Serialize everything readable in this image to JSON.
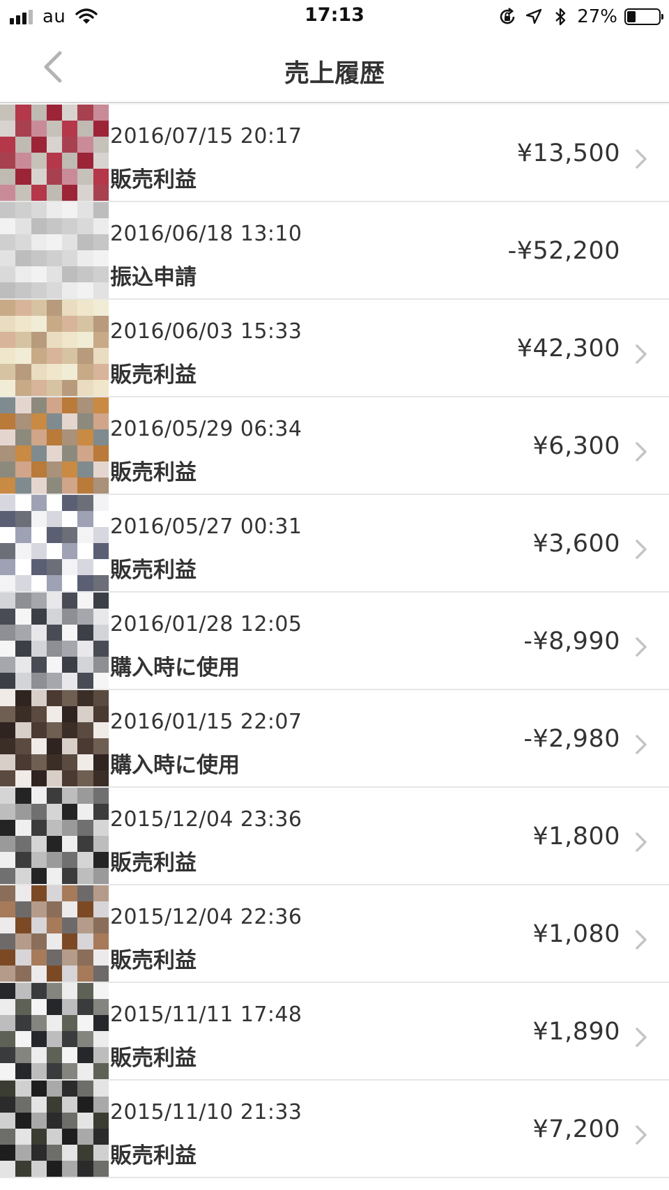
{
  "status_bar": {
    "carrier": "au",
    "time": "17:13",
    "battery_percent": "27%",
    "battery_level": 0.27,
    "signal_bars_active": 3,
    "signal_bars_total": 4,
    "icons": [
      "rotation-lock-icon",
      "location-icon",
      "bluetooth-icon"
    ]
  },
  "nav": {
    "title": "売上履歴",
    "back_icon": "chevron-left-icon"
  },
  "colors": {
    "chevron": "#c4c4c4",
    "back_arrow": "#b3b3b3",
    "separator": "#e6e6e6",
    "text": "#333333"
  },
  "transactions": [
    {
      "date": "2016/07/15 20:17",
      "type": "販売利益",
      "amount": "¥13,500",
      "has_chevron": true,
      "palette": [
        "#c6c1b9",
        "#a8414f",
        "#9c2437",
        "#b4374a",
        "#c98b98",
        "#d8d3cf",
        "#bfbab2"
      ]
    },
    {
      "date": "2016/06/18 13:10",
      "type": "振込申請",
      "amount": "-¥52,200",
      "has_chevron": false,
      "palette": [
        "#d9d9d9",
        "#c6c6c6",
        "#e2e2e2",
        "#ececec",
        "#cfcfcf",
        "#bdbdbd",
        "#f2f2f2"
      ]
    },
    {
      "date": "2016/06/03 15:33",
      "type": "販売利益",
      "amount": "¥42,300",
      "has_chevron": true,
      "palette": [
        "#e9dcc0",
        "#d6c3a2",
        "#c8aa86",
        "#efe6cb",
        "#b79b7c",
        "#d7b49a",
        "#f1ecd6"
      ]
    },
    {
      "date": "2016/05/29 06:34",
      "type": "販売利益",
      "amount": "¥6,300",
      "has_chevron": true,
      "palette": [
        "#c98a43",
        "#b97a3a",
        "#8c8a7d",
        "#7f8b8e",
        "#a9917a",
        "#d0a58a",
        "#e4d6cf"
      ]
    },
    {
      "date": "2016/05/27 00:31",
      "type": "販売利益",
      "amount": "¥3,600",
      "has_chevron": true,
      "palette": [
        "#ffffff",
        "#f3f3f5",
        "#5b5f74",
        "#9ea2b4",
        "#d7d8df",
        "#6c6e78",
        "#ffffff"
      ]
    },
    {
      "date": "2016/01/28 12:05",
      "type": "購入時に使用",
      "amount": "-¥8,990",
      "has_chevron": true,
      "palette": [
        "#e8e8ea",
        "#8d8f95",
        "#3d3f47",
        "#4a4c55",
        "#a6a7ad",
        "#d3d4d8",
        "#f5f5f6"
      ]
    },
    {
      "date": "2016/01/15 22:07",
      "type": "購入時に使用",
      "amount": "-¥2,980",
      "has_chevron": true,
      "palette": [
        "#3b2e27",
        "#4a3a31",
        "#2f241f",
        "#5b4a3f",
        "#6f5e52",
        "#d8cfc8",
        "#f0ebe6"
      ]
    },
    {
      "date": "2015/12/04 23:36",
      "type": "販売利益",
      "amount": "¥1,800",
      "has_chevron": true,
      "palette": [
        "#d5d5d5",
        "#9a9a9a",
        "#3c3c3c",
        "#242424",
        "#707070",
        "#bdbdbd",
        "#efefef"
      ]
    },
    {
      "date": "2015/12/04 22:36",
      "type": "販売利益",
      "amount": "¥1,080",
      "has_chevron": true,
      "palette": [
        "#7b4a24",
        "#8a6e5a",
        "#6e6a6a",
        "#d7d5d7",
        "#eceaea",
        "#b59c8a",
        "#a77a5a"
      ]
    },
    {
      "date": "2015/11/11 17:48",
      "type": "販売利益",
      "amount": "¥1,890",
      "has_chevron": true,
      "palette": [
        "#ededed",
        "#3a3b3d",
        "#26272a",
        "#5e6155",
        "#84857e",
        "#bdbdbd",
        "#f4f4f4"
      ]
    },
    {
      "date": "2015/11/10 21:33",
      "type": "販売利益",
      "amount": "¥7,200",
      "has_chevron": true,
      "palette": [
        "#e4e4e4",
        "#2b2b2b",
        "#1d1e1d",
        "#3b3d33",
        "#6d6d6a",
        "#a9a9a9",
        "#d0d0d0"
      ]
    }
  ]
}
